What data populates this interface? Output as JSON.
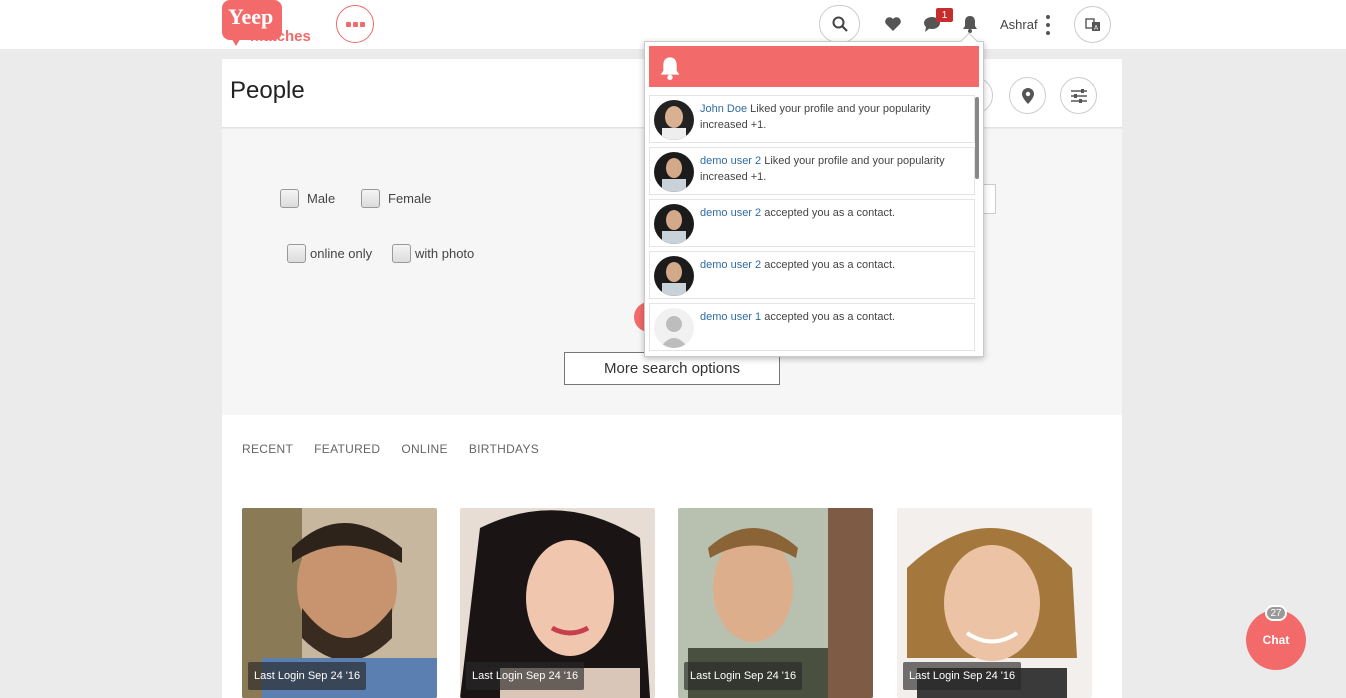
{
  "header": {
    "logo_word1": "Yeep",
    "logo_word2": "matches",
    "message_badge": "1",
    "username": "Ashraf"
  },
  "page": {
    "title": "People"
  },
  "filters": {
    "male": "Male",
    "female": "Female",
    "online_only": "online only",
    "with_photo": "with photo",
    "more_options": "More search options"
  },
  "tabs": [
    "RECENT",
    "FEATURED",
    "ONLINE",
    "BIRTHDAYS"
  ],
  "members": [
    {
      "last_login": "Last Login  Sep 24 '16"
    },
    {
      "last_login": "Last Login  Sep 24 '16"
    },
    {
      "last_login": "Last Login  Sep 24 '16"
    },
    {
      "last_login": "Last Login  Sep 24 '16"
    }
  ],
  "notifications": [
    {
      "user": "John Doe",
      "text": " Liked your profile and your popularity increased +1."
    },
    {
      "user": "demo user 2",
      "text": " Liked your profile and your popularity increased +1."
    },
    {
      "user": "demo user 2",
      "text": " accepted you as a contact."
    },
    {
      "user": "demo user 2",
      "text": " accepted you as a contact."
    },
    {
      "user": "demo user 1",
      "text": " accepted you as a contact."
    }
  ],
  "chat": {
    "label": "Chat",
    "badge": "27"
  },
  "colors": {
    "accent": "#f26a6a",
    "badge": "#c72d2d",
    "link": "#2e6da4"
  }
}
